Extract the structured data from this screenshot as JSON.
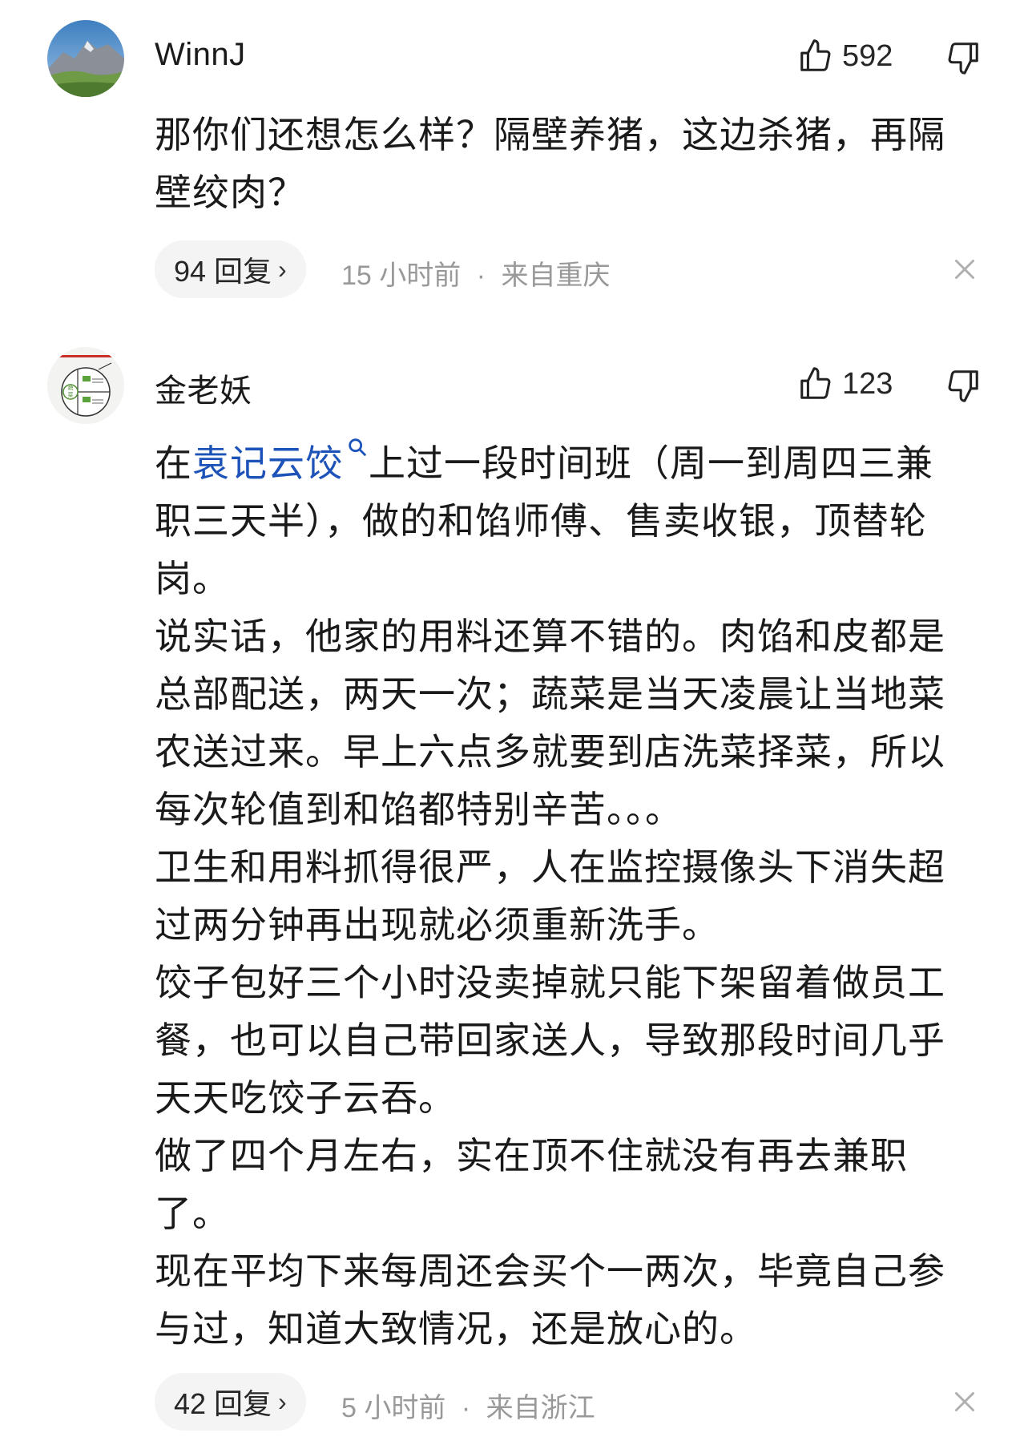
{
  "comments": [
    {
      "author": "WinnJ",
      "likes": "592",
      "text_lines": [
        "那你们还想怎么样？隔壁养猪，这边杀猪，再隔",
        "壁绞肉？"
      ],
      "reply_label": "94 回复",
      "time": "15 小时前",
      "location": "来自重庆"
    },
    {
      "author": "金老妖",
      "likes": "123",
      "keyword": "袁记云饺",
      "text_first_prefix": "在",
      "text_first_suffix": "上过一段时间班（周一到周四三兼",
      "text_lines": [
        "职三天半），做的和馅师傅、售卖收银，顶替轮",
        "岗。",
        "说实话，他家的用料还算不错的。肉馅和皮都是",
        "总部配送，两天一次；蔬菜是当天凌晨让当地菜",
        "农送过来。早上六点多就要到店洗菜择菜，所以",
        "每次轮值到和馅都特别辛苦。。。",
        "卫生和用料抓得很严，人在监控摄像头下消失超",
        "过两分钟再出现就必须重新洗手。",
        "饺子包好三个小时没卖掉就只能下架留着做员工",
        "餐，也可以自己带回家送人，导致那段时间几乎",
        "天天吃饺子云吞。",
        "做了四个月左右，实在顶不住就没有再去兼职",
        "了。",
        "现在平均下来每周还会买个一两次，毕竟自己参",
        "与过，知道大致情况，还是放心的。"
      ],
      "avatar_labels": {
        "top": "蔬菜",
        "left": "蔬",
        "left2": "菜",
        "q1": "主食",
        "q2": "肉类"
      },
      "reply_label": "42 回复",
      "time": "5 小时前",
      "location": "来自浙江"
    }
  ],
  "icons": {
    "like": "thumbs-up-icon",
    "dislike": "thumbs-down-icon",
    "close": "close-icon",
    "search": "search-icon",
    "chevron": "chevron-right-icon"
  },
  "colors": {
    "keyword": "#1d53b8",
    "meta": "#999999",
    "pill": "#f4f4f4"
  },
  "meta_separator": "·"
}
